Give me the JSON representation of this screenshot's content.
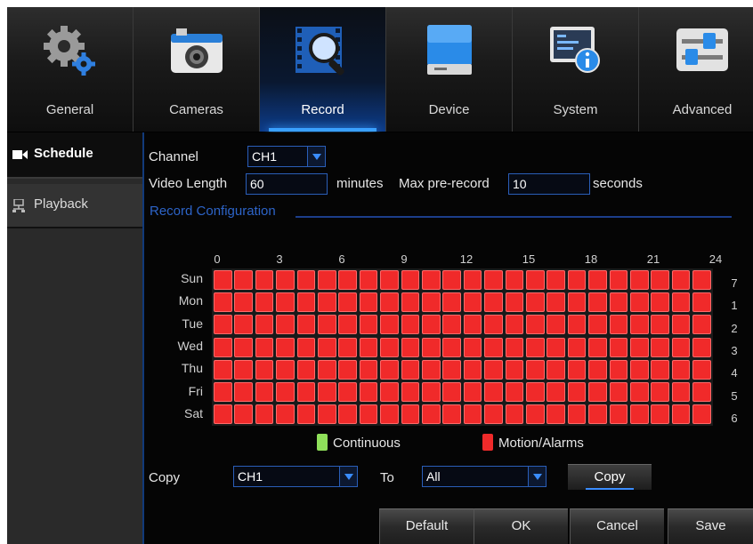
{
  "tabs": [
    {
      "label": "General",
      "icon": "gear-icon"
    },
    {
      "label": "Cameras",
      "icon": "camera-icon"
    },
    {
      "label": "Record",
      "icon": "film-magnifier-icon"
    },
    {
      "label": "Device",
      "icon": "hard-drive-icon"
    },
    {
      "label": "System",
      "icon": "system-info-icon"
    },
    {
      "label": "Advanced",
      "icon": "sliders-icon"
    }
  ],
  "active_tab": "Record",
  "sidebar": {
    "items": [
      {
        "label": "Schedule",
        "icon": "camera-record-icon"
      },
      {
        "label": "Playback",
        "icon": "network-icon"
      }
    ],
    "active": "Schedule"
  },
  "form": {
    "channel_label": "Channel",
    "channel_value": "CH1",
    "video_length_label": "Video Length",
    "video_length_value": "60",
    "minutes_label": "minutes",
    "max_prerecord_label": "Max pre-record",
    "max_prerecord_value": "10",
    "seconds_label": "seconds"
  },
  "schedule": {
    "section_title": "Record Configuration",
    "hour_labels": [
      "0",
      "3",
      "6",
      "9",
      "12",
      "15",
      "18",
      "21",
      "24"
    ],
    "days": [
      "Sun",
      "Mon",
      "Tue",
      "Wed",
      "Thu",
      "Fri",
      "Sat"
    ],
    "day_numbers": [
      "7",
      "1",
      "2",
      "3",
      "4",
      "5",
      "6"
    ],
    "hours_per_day": 24,
    "cell_state": "Motion/Alarms"
  },
  "legend": {
    "continuous_label": "Continuous",
    "continuous_color": "#8fe05a",
    "motion_label": "Motion/Alarms",
    "motion_color": "#f02a2a"
  },
  "copy_row": {
    "copy_label": "Copy",
    "from_value": "CH1",
    "to_label": "To",
    "to_value": "All",
    "copy_button": "Copy"
  },
  "buttons": {
    "default": "Default",
    "ok": "OK",
    "cancel": "Cancel",
    "save": "Save"
  },
  "colors": {
    "accent": "#3a8dff",
    "section_title": "#2d64c8"
  }
}
